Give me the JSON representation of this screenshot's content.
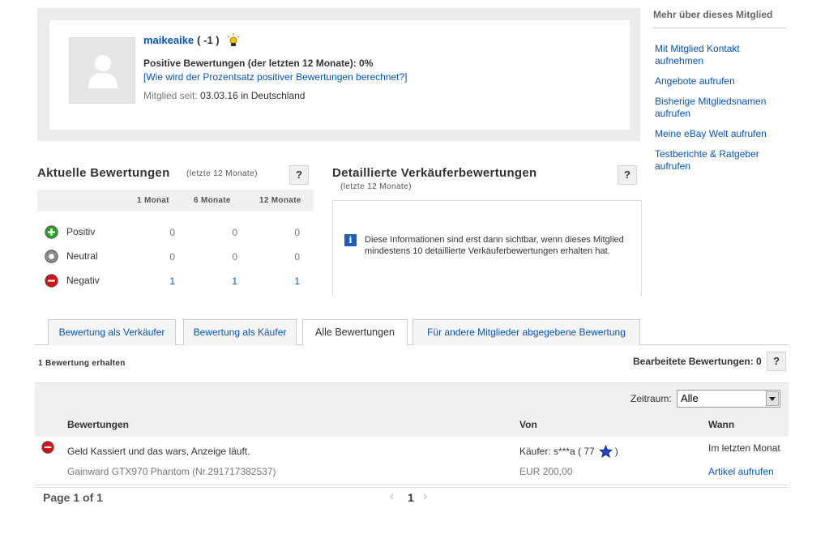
{
  "profile": {
    "username": "maikeaike",
    "score": "( -1 )",
    "positive_line": "Positive Bewertungen (der letzten 12 Monate): 0%",
    "positive_link": "[Wie wird der Prozentsatz positiver Bewertungen berechnet?]",
    "member_label": "Mitglied seit:",
    "member_value": "03.03.16 in Deutschland"
  },
  "sidebar": {
    "title": "Mehr über dieses Mitglied",
    "links": [
      "Mit Mitglied Kontakt aufnehmen",
      "Angebote aufrufen",
      "Bisherige Mitgliedsnamen aufrufen",
      "Meine eBay Welt aufrufen",
      "Testberichte & Ratgeber aufrufen"
    ]
  },
  "current_ratings": {
    "title": "Aktuelle Bewertungen",
    "subtitle": "(letzte 12 Monate)",
    "help": "?",
    "columns": [
      "1 Monat",
      "6 Monate",
      "12 Monate"
    ],
    "rows": [
      {
        "label": "Positiv",
        "values": [
          "0",
          "0",
          "0"
        ]
      },
      {
        "label": "Neutral",
        "values": [
          "0",
          "0",
          "0"
        ]
      },
      {
        "label": "Negativ",
        "values": [
          "1",
          "1",
          "1"
        ]
      }
    ]
  },
  "detailed": {
    "title": "Detaillierte Verkäuferbewertungen",
    "subtitle": "(letzte 12 Monate)",
    "help": "?",
    "info_icon": "i",
    "info": "Diese Informationen sind erst dann sichtbar, wenn dieses Mitglied mindestens 10 detaillierte Verkäuferbewertungen erhalten hat."
  },
  "tabs": [
    "Bewertung als Verkäufer",
    "Bewertung als Käufer",
    "Alle Bewertungen",
    "Für andere Mitglieder abgegebene Bewertung"
  ],
  "active_tab": 2,
  "feedback": {
    "count_label": "1 Bewertung erhalten",
    "edited_label": "Bearbeitete Bewertungen: 0",
    "help": "?",
    "period_label": "Zeitraum:",
    "period_value": "Alle",
    "columns": {
      "rating": "Bewertungen",
      "from": "Von",
      "when": "Wann"
    },
    "entries": [
      {
        "type": "negative",
        "comment": "Geld Kassiert und das wars, Anzeige läuft.",
        "item": "Gainward GTX970 Phantom (Nr.291717382537)",
        "from": "Käufer: s***a ( 77",
        "from_close": ")",
        "price": "EUR 200,00",
        "when": "Im letzten Monat",
        "link": "Artikel aufrufen"
      }
    ]
  },
  "pager": {
    "label": "Page 1 of 1",
    "current": "1",
    "prev": "‹",
    "next": "›"
  },
  "colors": {
    "link": "#0654ba",
    "positive": "#2a9d2a",
    "neutral": "#888888",
    "negative": "#d0121b",
    "star": "#1e3fd0"
  }
}
